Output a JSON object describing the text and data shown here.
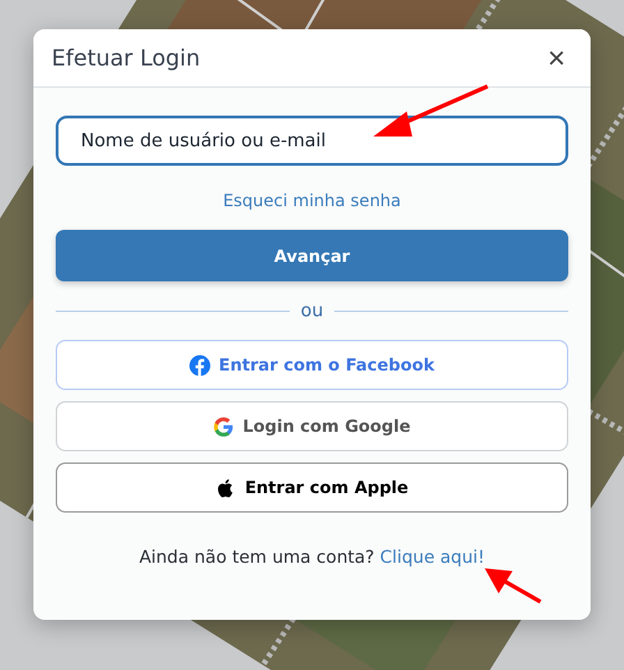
{
  "dialog": {
    "title": "Efetuar Login",
    "close": "×"
  },
  "login_field": {
    "value": "Nome de usuário ou e-mail"
  },
  "forgot_link": "Esqueci minha senha",
  "next_button": "Avançar",
  "divider": "ou",
  "social_buttons": [
    {
      "kind": "facebook",
      "label": "Entrar com o Facebook"
    },
    {
      "kind": "google",
      "label": "Login com Google"
    },
    {
      "kind": "apple",
      "label": "Entrar com Apple"
    }
  ],
  "signup": {
    "text": "Ainda não tem uma conta?",
    "link": "Clique aqui!"
  }
}
